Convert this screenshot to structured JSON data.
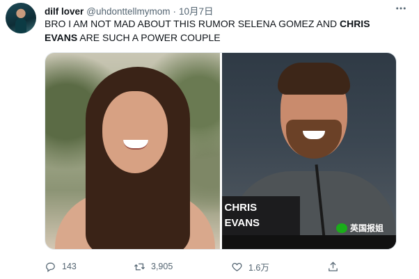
{
  "tweet": {
    "author_name": "dilf lover",
    "author_handle": "@uhdonttellmymom",
    "separator": "·",
    "date": "10月7日",
    "text_part1": "BRO I AM NOT MAD ABOUT THIS RUMOR SELENA GOMEZ AND ",
    "text_bold1": "CHRIS",
    "text_newline_bold": "EVANS",
    "text_part2": " ARE SUCH A POWER COUPLE"
  },
  "media": {
    "nameplate_line1": "CHRIS",
    "nameplate_line2": "EVANS"
  },
  "actions": {
    "reply_count": "143",
    "retweet_count": "3,905",
    "like_count": "1.6万"
  },
  "watermark": {
    "text": "英国报姐",
    "icon": "wechat-icon"
  },
  "icons": {
    "more": "more-icon",
    "reply": "reply-icon",
    "retweet": "retweet-icon",
    "like": "heart-icon",
    "share": "share-icon"
  },
  "colors": {
    "text_primary": "#0f1419",
    "text_secondary": "#536471"
  }
}
